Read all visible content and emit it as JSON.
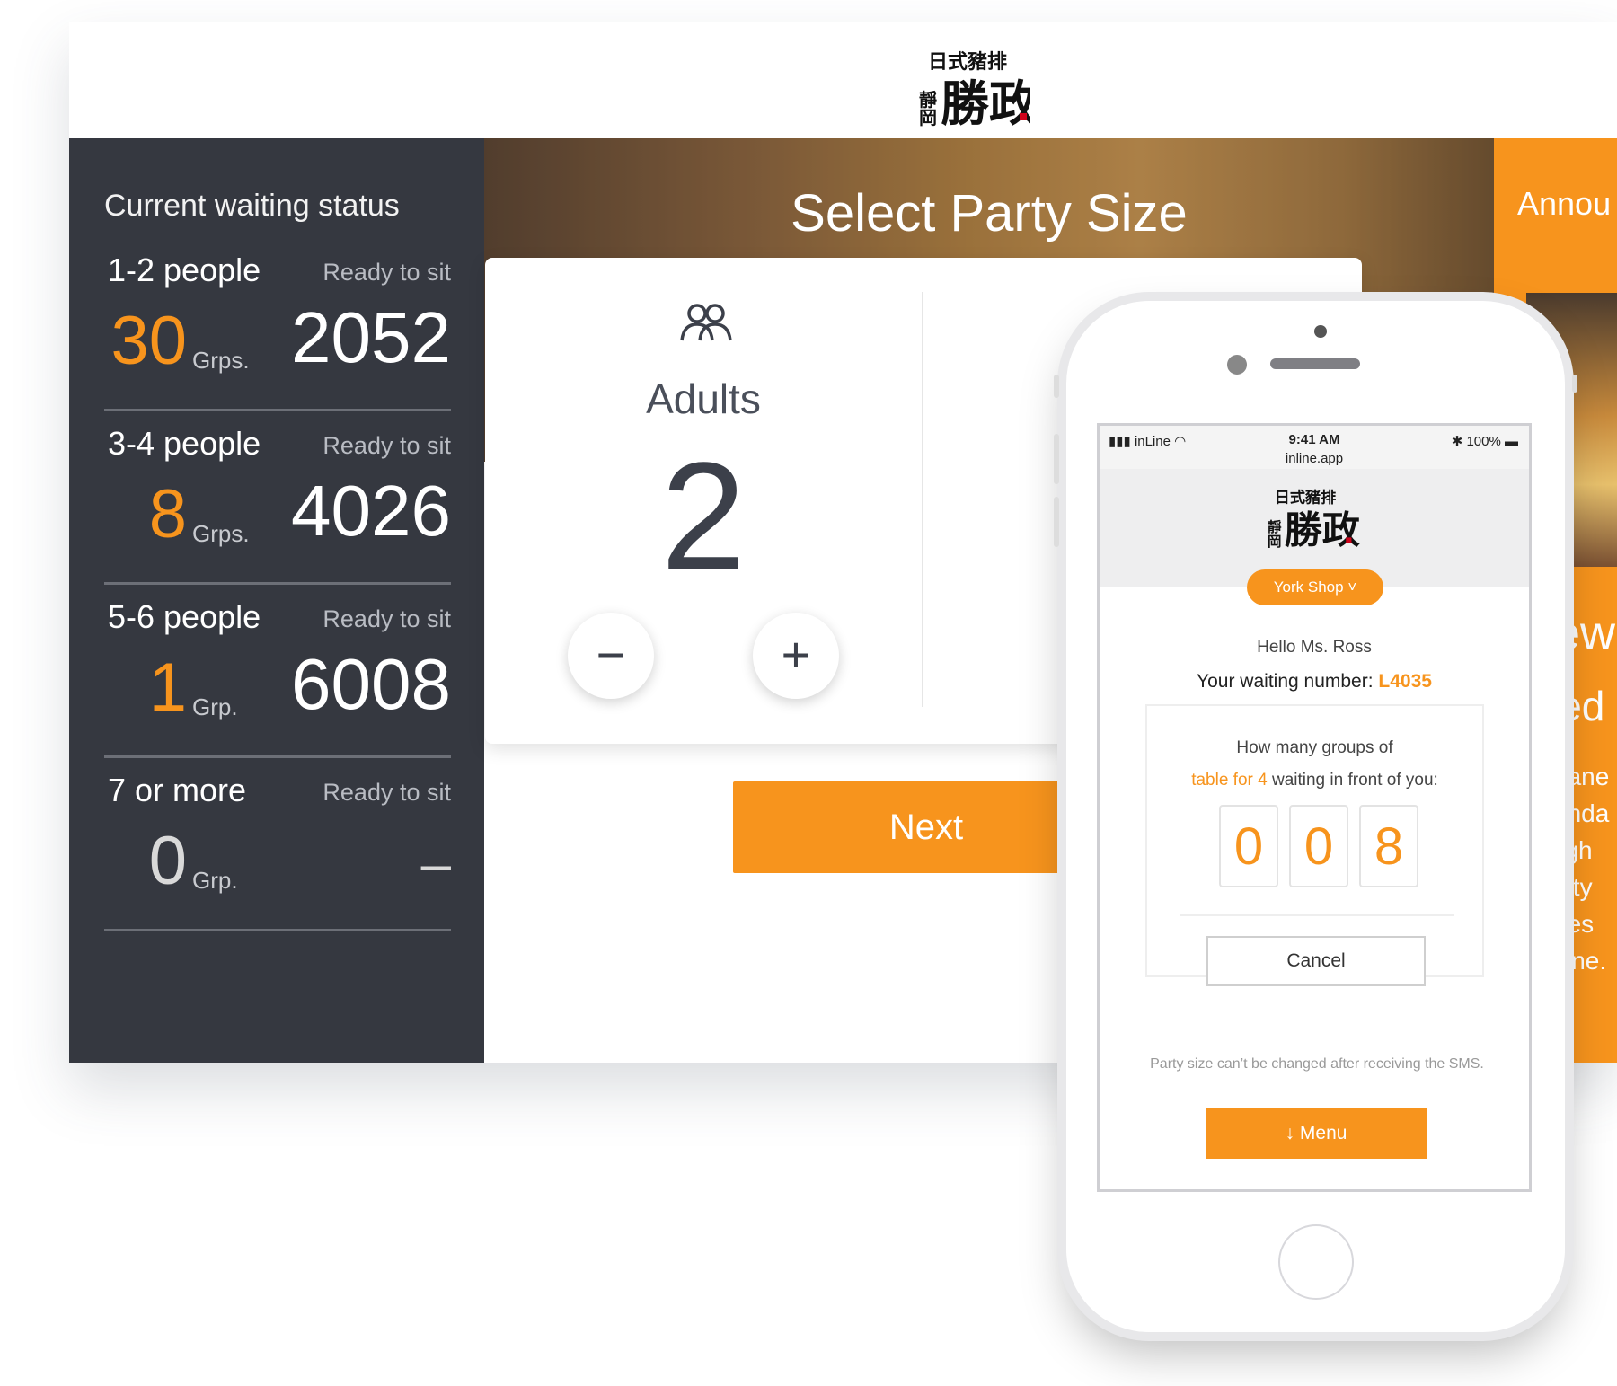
{
  "colors": {
    "accent": "#f7941d",
    "sidebar_bg": "#353840"
  },
  "brand_logo_text": "日式豬排 靜岡 勝政",
  "sidebar": {
    "title": "Current waiting status",
    "groups": [
      {
        "label": "1-2 people",
        "status": "Ready to sit",
        "count": "30",
        "unit": "Grps.",
        "number": "2052"
      },
      {
        "label": "3-4 people",
        "status": "Ready to sit",
        "count": "8",
        "unit": "Grps.",
        "number": "4026"
      },
      {
        "label": "5-6 people",
        "status": "Ready to sit",
        "count": "1",
        "unit": "Grp.",
        "number": "6008"
      },
      {
        "label": "7 or more",
        "status": "Ready to sit",
        "count": "0",
        "unit": "Grp.",
        "number": "–"
      }
    ]
  },
  "main": {
    "title": "Select Party Size",
    "adults_label": "Adults",
    "adults_value": "2",
    "minus_symbol": "−",
    "plus_symbol": "+",
    "next_label": "Next"
  },
  "right_panel": {
    "heading": "Annou",
    "big1": "ew",
    "big2": "ied",
    "lines": [
      "pane",
      "unda",
      "ligh",
      "iety",
      "hes",
      "sine."
    ]
  },
  "phone": {
    "carrier": "inLine",
    "time": "9:41 AM",
    "url": "inline.app",
    "battery": "100%",
    "shop": "York Shop",
    "hello": "Hello Ms. Ross",
    "waiting_label": "Your waiting number:",
    "waiting_number": "L4035",
    "groups_q1": "How many groups of",
    "groups_q2_orange": "table for 4",
    "groups_q2_rest": "waiting in front of you:",
    "digits": [
      "0",
      "0",
      "8"
    ],
    "cancel": "Cancel",
    "note": "Party size can’t be changed after receiving the SMS.",
    "menu": "Menu"
  }
}
